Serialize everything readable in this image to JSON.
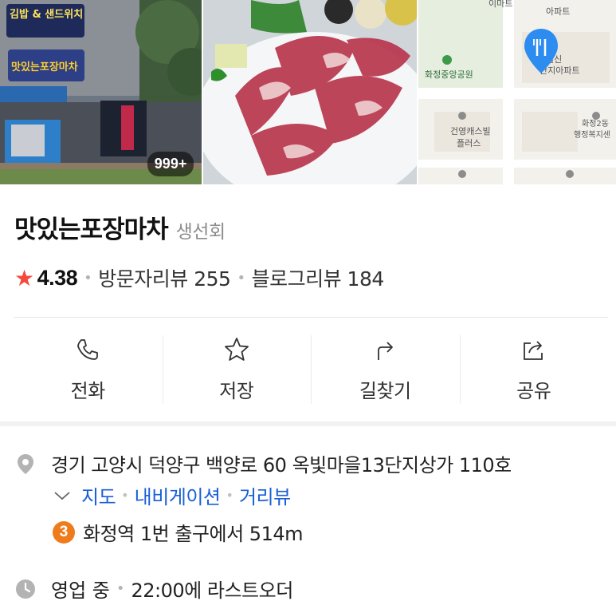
{
  "photos": {
    "count_badge": "999+",
    "store_signs": [
      "김밥 & 샌드위치",
      "맛있는포장마차"
    ],
    "map_labels": {
      "park": "화정중앙공원",
      "apt1": "일신",
      "apt1b": "단지아파트",
      "apt_top": "아파트",
      "mart": "이마트",
      "villa": "건영캐스빌",
      "villa2": "플러스",
      "office1": "화정2동",
      "office2": "행정복지센"
    }
  },
  "place": {
    "name": "맛있는포장마차",
    "category": "생선회"
  },
  "rating": {
    "score": "4.38",
    "visitor_reviews": "방문자리뷰 255",
    "blog_reviews": "블로그리뷰 184"
  },
  "actions": [
    {
      "label": "전화",
      "icon": "phone-icon"
    },
    {
      "label": "저장",
      "icon": "star-icon"
    },
    {
      "label": "길찾기",
      "icon": "directions-icon"
    },
    {
      "label": "공유",
      "icon": "share-icon"
    }
  ],
  "info": {
    "address": "경기 고양시 덕양구 백양로 60 옥빛마을13단지상가 110호",
    "links": [
      "지도",
      "내비게이션",
      "거리뷰"
    ],
    "subway_line": "3",
    "station": "화정역 1번 출구에서 514m",
    "hours_status": "영업 중",
    "hours_detail": "22:00에 라스트오더"
  },
  "colors": {
    "accent_link": "#1a5fd6",
    "star": "#f5493d",
    "line3": "#ef7c1c",
    "map_pin": "#2d8cf0"
  }
}
